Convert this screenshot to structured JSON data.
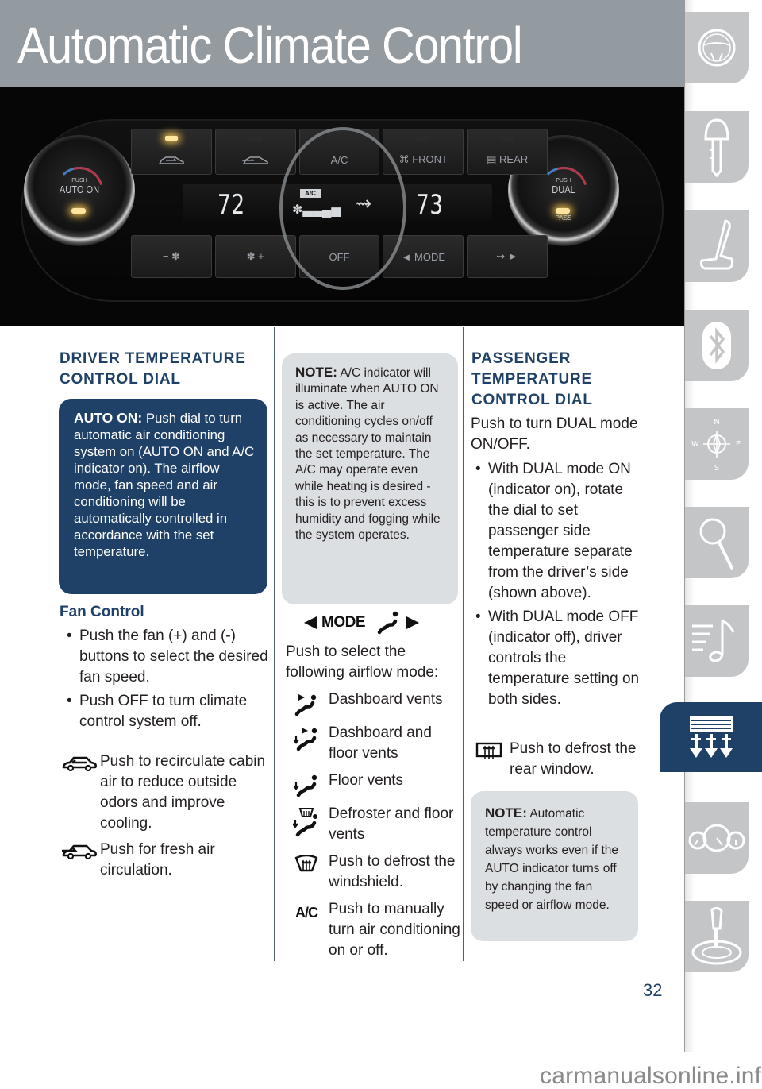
{
  "header": {
    "title": "Automatic Climate Control"
  },
  "photo": {
    "description": "climate-control-panel",
    "top_buttons": [
      {
        "icon": "recirculate-icon",
        "led_on": true
      },
      {
        "icon": "fresh-air-icon",
        "led_on": false
      },
      {
        "label": "A/C"
      },
      {
        "icon": "front-defrost-icon",
        "label": "FRONT",
        "led_on": false
      },
      {
        "icon": "rear-defrost-icon",
        "label": "REAR",
        "led_on": false
      }
    ],
    "bottom_buttons": [
      {
        "label": "− ✽",
        "meaning": "fan-down"
      },
      {
        "label": "✽ +",
        "meaning": "fan-up"
      },
      {
        "label": "OFF"
      },
      {
        "label": "◄ MODE"
      },
      {
        "label": "⇝ ►",
        "meaning": "mode-forward"
      }
    ],
    "display": {
      "driver_temp": "72",
      "passenger_temp": "73",
      "ac_indicator": "A/C"
    },
    "left_dial": {
      "push": "PUSH",
      "label": "AUTO ON"
    },
    "right_dial": {
      "push": "PUSH",
      "label": "DUAL",
      "sub": "PASS"
    }
  },
  "col1": {
    "heading": "DRIVER TEMPERATURE CONTROL DIAL",
    "auto_box": {
      "lead": "AUTO ON:",
      "text": " Push dial to turn automatic air conditioning system on (AUTO ON and A/C indicator on). The airflow mode, fan speed and air conditioning will be automatically controlled in accordance with the set temperature."
    },
    "fan_title": "Fan Control",
    "fan_bullets": [
      "Push the fan (+) and (-) buttons to select the desired fan speed.",
      "Push OFF to turn climate control system off."
    ],
    "recirc": {
      "icon": "recirculate-icon",
      "text": "Push to recirculate cabin air to reduce outside odors and improve cooling."
    },
    "fresh": {
      "icon": "fresh-air-icon",
      "text": "Push for fresh air circulation."
    }
  },
  "col2": {
    "note": {
      "lead": "NOTE:",
      "text": " A/C indicator will illuminate when AUTO ON is active. The air conditioning cycles on/off as necessary to maintain the set temperature. The A/C may operate even while heating is desired - this is to prevent excess humidity and fogging while the system operates."
    },
    "mode_label": "MODE",
    "intro": "Push to select the following airflow mode:",
    "modes": [
      {
        "icon": "dashboard-vents-icon",
        "text": "Dashboard vents"
      },
      {
        "icon": "dashboard-floor-vents-icon",
        "text": "Dashboard and floor vents"
      },
      {
        "icon": "floor-vents-icon",
        "text": "Floor vents"
      },
      {
        "icon": "defroster-floor-vents-icon",
        "text": "Defroster and floor vents"
      },
      {
        "icon": "windshield-defrost-icon",
        "text": "Push to defrost the windshield."
      },
      {
        "icon": "ac-icon",
        "glyph": "A/C",
        "text": "Push to manually turn air conditioning on or off."
      }
    ]
  },
  "col3": {
    "heading": "PASSENGER TEMPERATURE CONTROL DIAL",
    "intro": "Push to turn DUAL mode ON/OFF.",
    "bullets": [
      "With DUAL mode ON (indicator on), rotate the dial to set passenger side temperature separate from the driver’s side (shown above).",
      "With DUAL mode OFF (indicator off), driver controls the temperature setting on both sides."
    ],
    "rear": {
      "icon": "rear-defrost-icon",
      "text": "Push to defrost the rear window."
    },
    "note": {
      "lead": "NOTE:",
      "text": " Automatic temperature control always works even if the AUTO indicator turns off by changing the fan speed or airflow mode."
    }
  },
  "side_tabs": [
    {
      "icon": "steering-wheel-icon",
      "active": false
    },
    {
      "icon": "key-icon",
      "active": false
    },
    {
      "icon": "seat-icon",
      "active": false
    },
    {
      "icon": "bluetooth-icon",
      "active": false
    },
    {
      "icon": "compass-icon",
      "active": false,
      "letters": [
        "N",
        "W",
        "E",
        "S"
      ]
    },
    {
      "icon": "magnifier-icon",
      "active": false
    },
    {
      "icon": "audio-icon",
      "active": false
    },
    {
      "icon": "climate-icon",
      "active": true
    },
    {
      "icon": "gauges-icon",
      "active": false
    },
    {
      "icon": "shifter-icon",
      "active": false
    }
  ],
  "footer": {
    "page_number": "32",
    "watermark": "carmanualsonline.info"
  },
  "colors": {
    "brand_navy": "#1f4167",
    "header_gray": "#939aa0",
    "note_gray": "#dcdfe2",
    "tab_gray": "#c4c5c7"
  }
}
